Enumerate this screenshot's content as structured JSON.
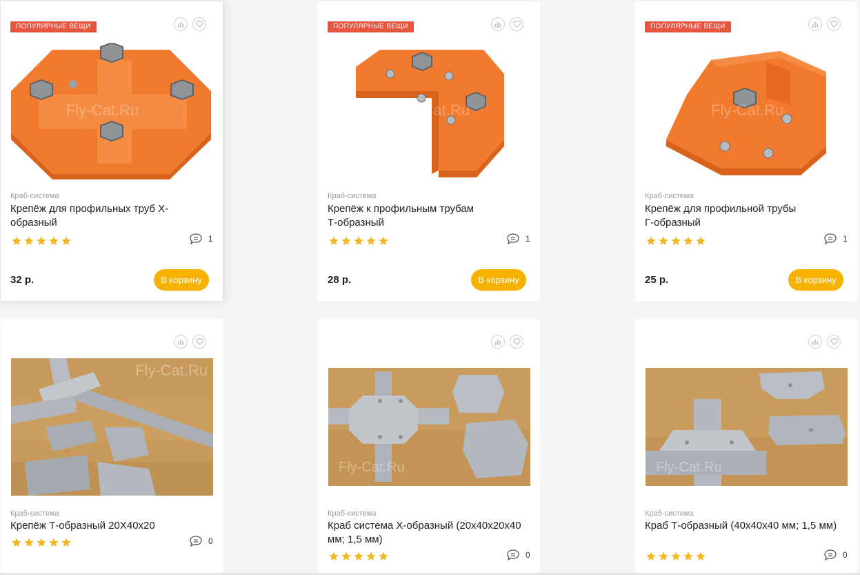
{
  "products": [
    {
      "badge": "популярные вещи",
      "brand": "Краб-система",
      "title": "Крепёж для профильных труб Х-образный",
      "rating": 5,
      "reviews": "1",
      "price": "32 р.",
      "cart_label": "В корзину",
      "watermark": "Fly-Cat.Ru"
    },
    {
      "badge": "популярные вещи",
      "brand": "Краб-система",
      "title": "Крепёж к профильным трубам Т-образный",
      "rating": 5,
      "reviews": "1",
      "price": "28 р.",
      "cart_label": "В корзину",
      "watermark": "Fly-Cat.Ru"
    },
    {
      "badge": "популярные вещи",
      "brand": "Краб-система",
      "title": "Крепёж для профильной трубы Г-образный",
      "rating": 5,
      "reviews": "1",
      "price": "25 р.",
      "cart_label": "В корзину",
      "watermark": "Fly-Cat.Ru"
    },
    {
      "brand": "Краб-система",
      "title": "Крепёж Т-образный 20Х40х20",
      "rating": 5,
      "reviews": "0",
      "watermark": "Fly-Cat.Ru"
    },
    {
      "brand": "Краб-система",
      "title": "Краб система Х-образный (20х40х20х40 мм; 1,5 мм)",
      "rating": 5,
      "reviews": "0",
      "watermark": "Fly-Cat.Ru"
    },
    {
      "brand": "Краб-система",
      "title": "Краб Т-образный (40х40х40 мм; 1,5 мм)",
      "rating": 5,
      "reviews": "0",
      "watermark": "Fly-Cat.Ru"
    }
  ],
  "colors": {
    "badge": "#e8553e",
    "cart_button": "#f7b100",
    "star": "#f2b927",
    "product_orange": "#f27a2e"
  },
  "icons": {
    "compare": "bar-chart-icon",
    "favorite": "heart-icon",
    "reviews": "speech-bubble-icon",
    "rating": "star-icon"
  }
}
